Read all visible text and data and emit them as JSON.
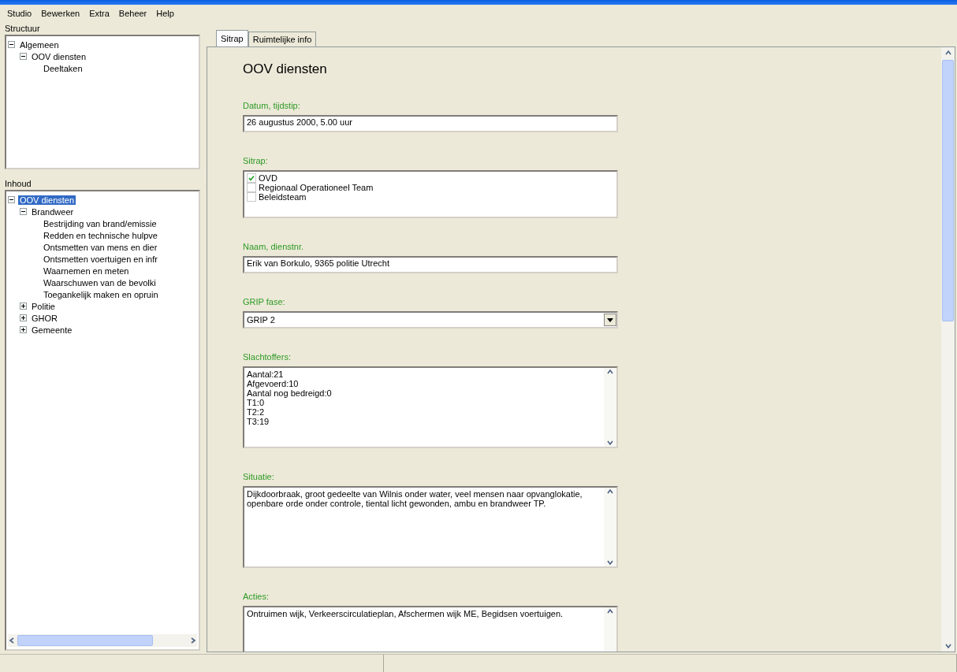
{
  "menu": [
    "Studio",
    "Bewerken",
    "Extra",
    "Beheer",
    "Help"
  ],
  "structure": {
    "title": "Structuur",
    "tree": [
      {
        "label": "Algemeen",
        "expanded": true,
        "selected": false,
        "children": [
          {
            "label": "OOV diensten",
            "expanded": true,
            "selected": false,
            "children": [
              {
                "label": "Deeltaken",
                "selected": false
              }
            ]
          }
        ]
      }
    ]
  },
  "contents": {
    "title": "Inhoud",
    "tree": [
      {
        "label": "OOV diensten",
        "expanded": true,
        "selected": true,
        "children": [
          {
            "label": "Brandweer",
            "expanded": true,
            "selected": false,
            "children": [
              {
                "label": "Bestrijding van brand/emissie",
                "selected": false
              },
              {
                "label": "Redden en technische hulpve",
                "selected": false
              },
              {
                "label": "Ontsmetten van mens en dier",
                "selected": false
              },
              {
                "label": "Ontsmetten voertuigen en infr",
                "selected": false
              },
              {
                "label": "Waarnemen en meten",
                "selected": false
              },
              {
                "label": "Waarschuwen van de bevolki",
                "selected": false
              },
              {
                "label": "Toegankelijk maken en opruin",
                "selected": false
              }
            ]
          },
          {
            "label": "Politie",
            "expanded": false,
            "selected": false
          },
          {
            "label": "GHOR",
            "expanded": false,
            "selected": false
          },
          {
            "label": "Gemeente",
            "expanded": false,
            "selected": false
          }
        ]
      }
    ]
  },
  "tabs": [
    {
      "label": "Sitrap",
      "selected": true
    },
    {
      "label": "Ruimtelijke info",
      "selected": false
    }
  ],
  "form": {
    "title": "OOV diensten",
    "fields": [
      {
        "kind": "text",
        "label": "Datum, tijdstip:",
        "value": "26 augustus 2000, 5.00 uur"
      },
      {
        "kind": "checklist",
        "label": "Sitrap:",
        "options": [
          {
            "label": "OVD",
            "checked": true
          },
          {
            "label": "Regionaal Operationeel Team",
            "checked": false
          },
          {
            "label": "Beleidsteam",
            "checked": false
          }
        ]
      },
      {
        "kind": "text",
        "label": "Naam, dienstnr.",
        "value": "Erik van Borkulo, 9365 politie Utrecht"
      },
      {
        "kind": "select",
        "label": "GRIP fase:",
        "value": "GRIP 2"
      },
      {
        "kind": "textarea",
        "label": "Slachtoffers:",
        "value": "Aantal:21\nAfgevoerd:10\nAantal nog bedreigd:0\nT1:0\nT2:2\nT3:19"
      },
      {
        "kind": "textarea",
        "label": "Situatie:",
        "value": "Dijkdoorbraak, groot gedeelte van Wilnis onder water, veel mensen naar opvanglokatie, openbare orde onder controle, tiental licht gewonden, ambu en brandweer TP."
      },
      {
        "kind": "textarea",
        "label": "Acties:",
        "value": "Ontruimen wijk, Verkeerscirculatieplan, Afschermen wijk ME, Begidsen voertuigen."
      }
    ]
  }
}
